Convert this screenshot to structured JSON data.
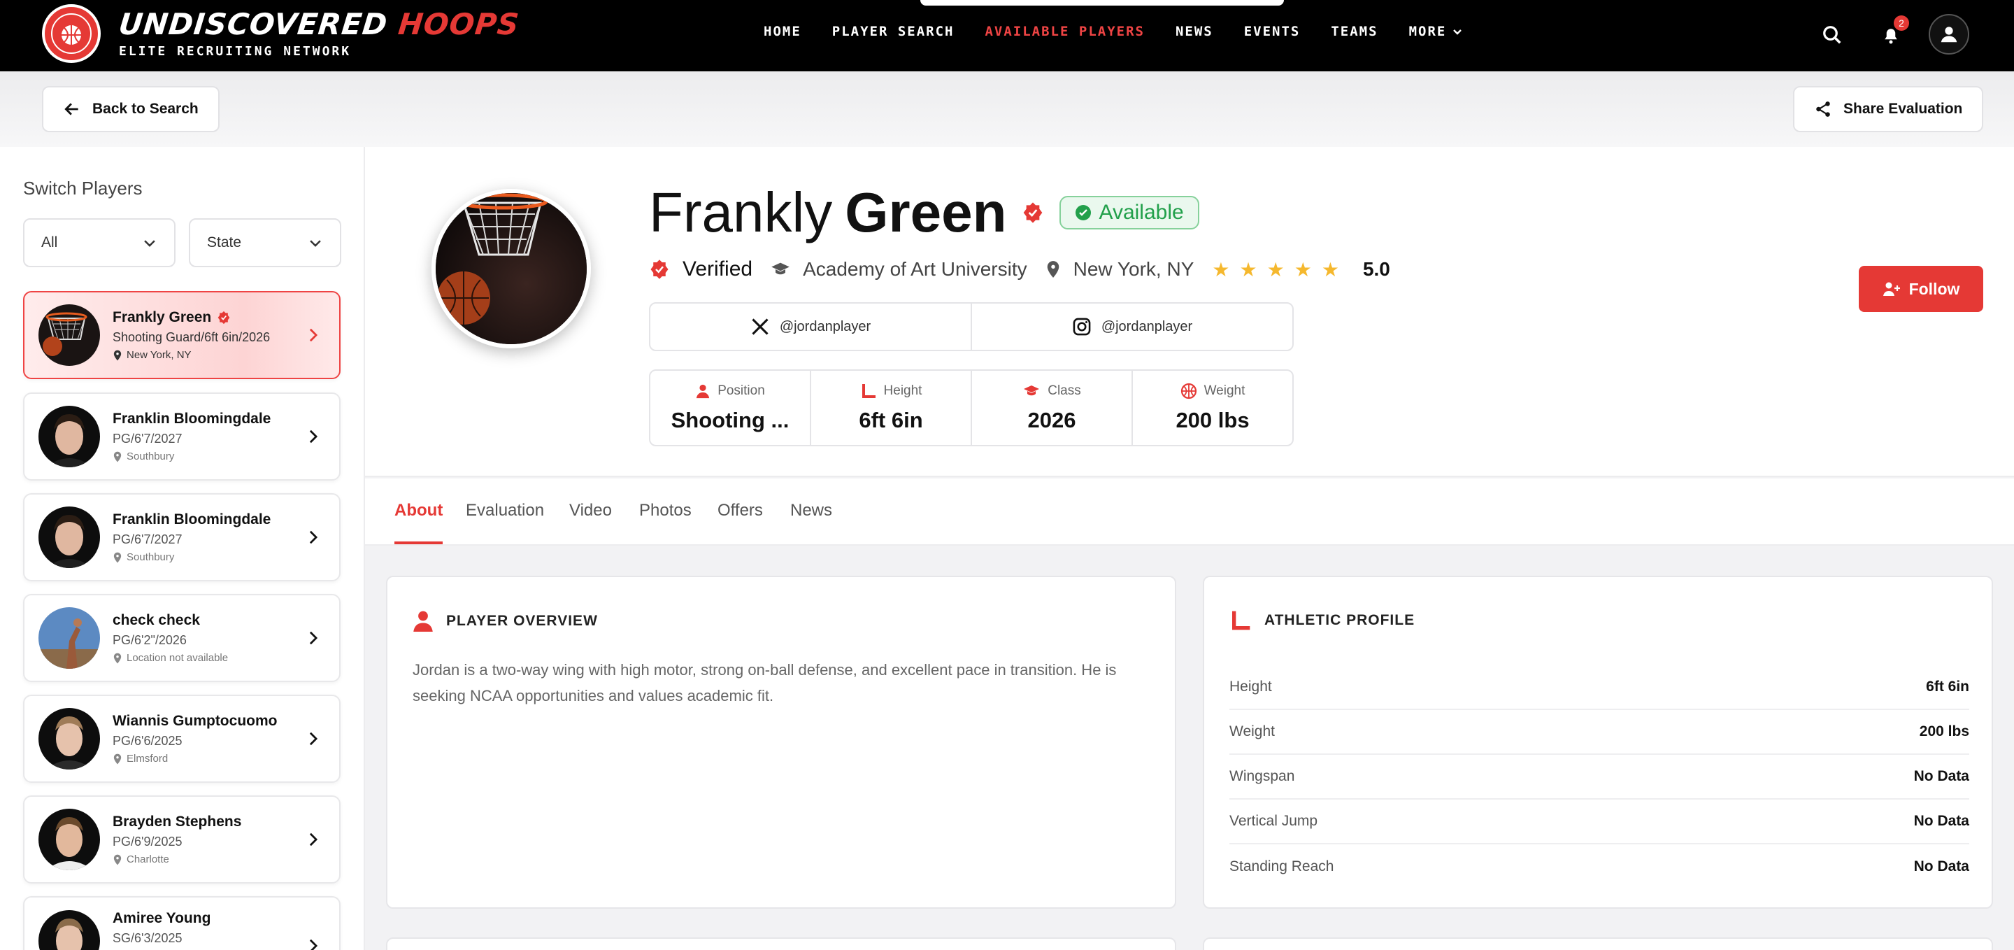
{
  "nav": {
    "brand_main": "UNDISCOVERED",
    "brand_accent": "HOOPS",
    "brand_sub": "ELITE RECRUITING NETWORK",
    "seal_text": "UNDISCOVERED HOOPS",
    "menu": [
      "HOME",
      "PLAYER SEARCH",
      "AVAILABLE PLAYERS",
      "NEWS",
      "EVENTS",
      "TEAMS",
      "MORE"
    ],
    "active_menu": "AVAILABLE PLAYERS",
    "notification_count": "2",
    "icons": [
      "search-icon",
      "bell-icon",
      "user-icon"
    ]
  },
  "toolbar": {
    "back_label": "Back to Search",
    "share_label": "Share Evaluation"
  },
  "sidebar": {
    "title": "Switch Players",
    "filter_all": "All",
    "filter_state": "State",
    "players": [
      {
        "name": "Frankly Green",
        "meta": "Shooting Guard/6ft 6in/2026",
        "location": "New York, NY",
        "verified": true,
        "selected": true
      },
      {
        "name": "Franklin Bloomingdale",
        "meta": "PG/6'7/2027",
        "location": "Southbury"
      },
      {
        "name": "Franklin Bloomingdale",
        "meta": "PG/6'7/2027",
        "location": "Southbury"
      },
      {
        "name": "check check",
        "meta": "PG/6'2\"/2026",
        "location": "Location not available"
      },
      {
        "name": "Wiannis Gumptocuomo",
        "meta": "PG/6'6/2025",
        "location": "Elmsford"
      },
      {
        "name": "Brayden Stephens",
        "meta": "PG/6'9/2025",
        "location": "Charlotte"
      },
      {
        "name": "Amiree Young",
        "meta": "SG/6'3/2025",
        "location": ""
      }
    ]
  },
  "profile": {
    "first_name": "Frankly",
    "last_name": "Green",
    "status": "Available",
    "verified_label": "Verified",
    "school": "Academy of Art University",
    "location": "New York, NY",
    "rating": "5.0",
    "rating_value": 5,
    "twitter": "@jordanplayer",
    "instagram": "@jordanplayer",
    "follow_label": "Follow",
    "stats": [
      {
        "label": "Position",
        "value": "Shooting ...",
        "icon": "user-icon"
      },
      {
        "label": "Height",
        "value": "6ft 6in",
        "icon": "ruler-icon"
      },
      {
        "label": "Class",
        "value": "2026",
        "icon": "graduation-cap-icon"
      },
      {
        "label": "Weight",
        "value": "200 lbs",
        "icon": "basketball-icon"
      }
    ]
  },
  "tabs": [
    "About",
    "Evaluation",
    "Video",
    "Photos",
    "Offers",
    "News"
  ],
  "active_tab": "About",
  "overview": {
    "title": "PLAYER OVERVIEW",
    "text": "Jordan is a two-way wing with high motor, strong on-ball defense, and excellent pace in transition. He is seeking NCAA opportunities and values academic fit."
  },
  "athletic": {
    "title": "ATHLETIC PROFILE",
    "rows": [
      {
        "label": "Height",
        "value": "6ft 6in"
      },
      {
        "label": "Weight",
        "value": "200 lbs"
      },
      {
        "label": "Wingspan",
        "value": "No Data"
      },
      {
        "label": "Vertical Jump",
        "value": "No Data"
      },
      {
        "label": "Standing Reach",
        "value": "No Data"
      }
    ]
  },
  "colors": {
    "accent": "#e53935",
    "available": "#22a04b",
    "star": "#f5b82e"
  }
}
